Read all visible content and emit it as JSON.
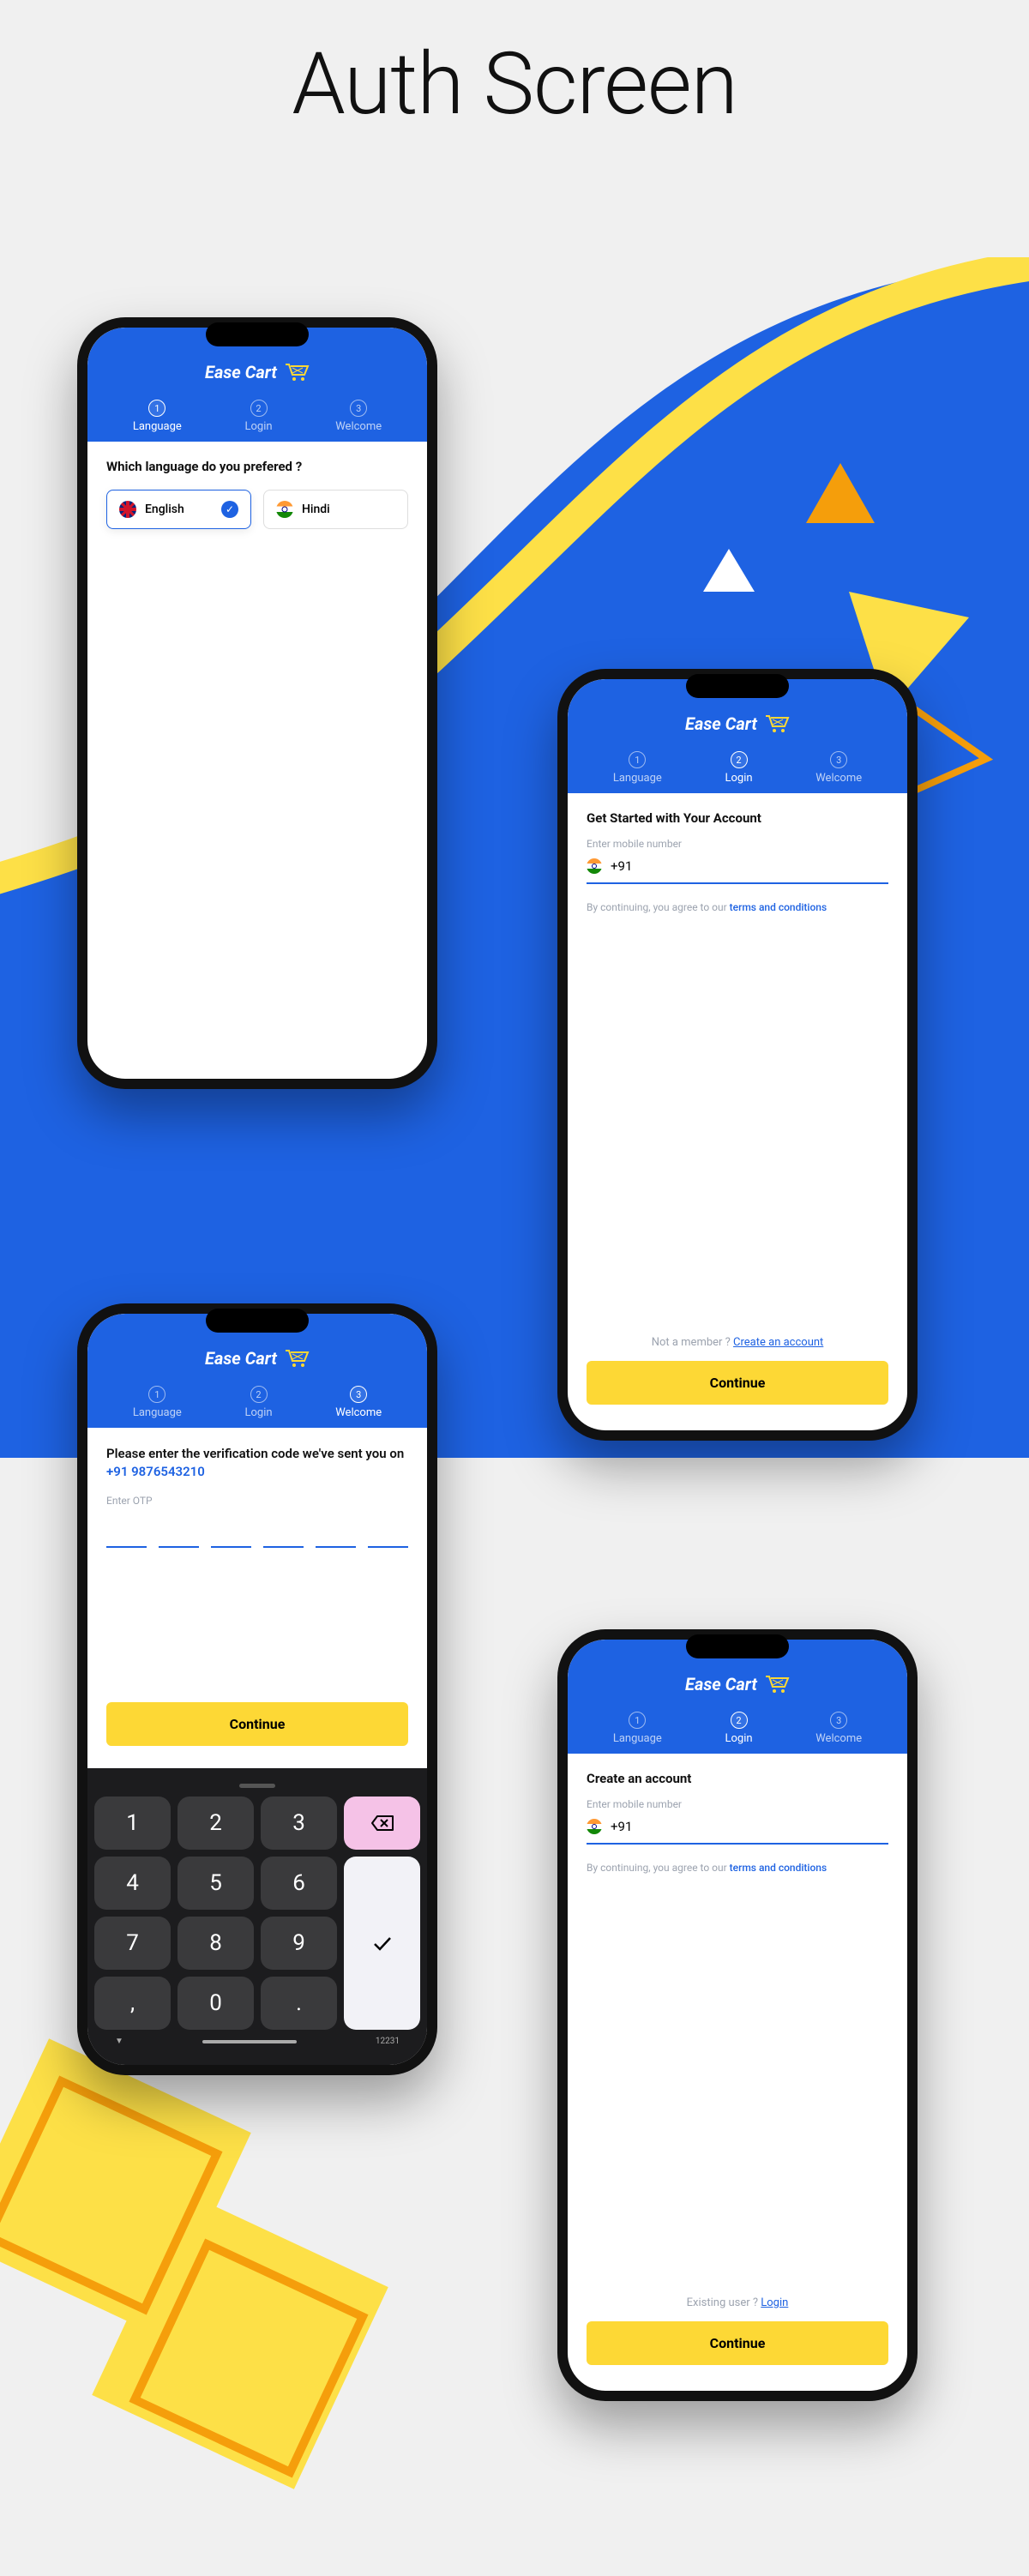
{
  "page_title": "Auth Screen",
  "brand": "Ease Cart",
  "stepper": [
    {
      "num": "1",
      "label": "Language"
    },
    {
      "num": "2",
      "label": "Login"
    },
    {
      "num": "3",
      "label": "Welcome"
    }
  ],
  "screen_language": {
    "question": "Which language do you prefered ?",
    "options": [
      {
        "label": "English",
        "selected": true
      },
      {
        "label": "Hindi",
        "selected": false
      }
    ]
  },
  "screen_login": {
    "title": "Get Started with Your Account",
    "placeholder": "Enter mobile number",
    "dial_code": "+91",
    "disclaimer_pre": "By continuing, you agree to our ",
    "disclaimer_link": "terms and conditions",
    "helper_pre": "Not a member ? ",
    "helper_link": "Create an account",
    "cta": "Continue"
  },
  "screen_otp": {
    "msg_pre": "Please enter the verification code we've sent you on ",
    "msg_blue": "+91 9876543210",
    "placeholder": "Enter OTP",
    "cta": "Continue",
    "keys": [
      "1",
      "2",
      "3",
      "4",
      "5",
      "6",
      "7",
      "8",
      "9",
      "0",
      ",",
      "."
    ],
    "time_indicator": "12231"
  },
  "screen_signup": {
    "title": "Create an account",
    "placeholder": "Enter mobile number",
    "dial_code": "+91",
    "disclaimer_pre": "By continuing, you agree to our ",
    "disclaimer_link": "terms and conditions",
    "helper_pre": "Existing user ? ",
    "helper_link": "Login",
    "cta": "Continue"
  }
}
